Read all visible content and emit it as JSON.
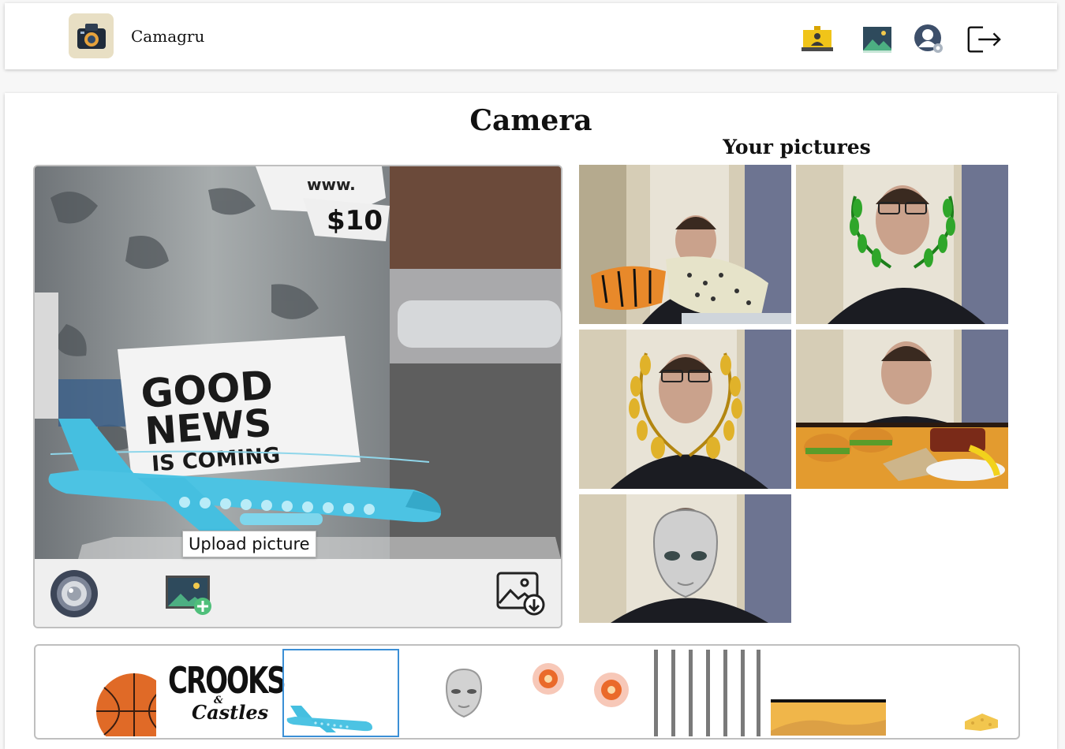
{
  "app": {
    "brand": "Camagru"
  },
  "nav": [
    {
      "id": "webcam",
      "icon": "webcam-icon"
    },
    {
      "id": "gallery",
      "icon": "gallery-icon"
    },
    {
      "id": "account",
      "icon": "user-settings-icon"
    },
    {
      "id": "logout",
      "icon": "logout-icon"
    }
  ],
  "main": {
    "title": "Camera",
    "pictures_title": "Your pictures"
  },
  "camera": {
    "poster_text": [
      "GOOD",
      "NEWS",
      "IS COMING"
    ],
    "sign_text": [
      "www.",
      "$10"
    ],
    "overlay": "airplane",
    "tooltip": "Upload picture"
  },
  "toolbar": {
    "capture_icon": "camera-lens-icon",
    "upload_icon": "upload-picture-icon",
    "save_icon": "download-picture-icon"
  },
  "pictures": [
    {
      "overlay": "tiger-leopard"
    },
    {
      "overlay": "green-laurel"
    },
    {
      "overlay": "gold-laurel"
    },
    {
      "overlay": "food"
    },
    {
      "overlay": "mask"
    }
  ],
  "filters": [
    {
      "name": "basketball"
    },
    {
      "name": "crooks-castles",
      "text_top": "CROOKS",
      "text_mid": "&",
      "text_bottom": "Castles"
    },
    {
      "name": "airplane",
      "selected": true
    },
    {
      "name": "mask"
    },
    {
      "name": "fire-orbs"
    },
    {
      "name": "prison-bars"
    },
    {
      "name": "desert-frame"
    },
    {
      "name": "cheese"
    }
  ],
  "colors": {
    "accent": "#3b8fd6",
    "plane": "#4cc3e3",
    "border": "#bfbfbf"
  }
}
